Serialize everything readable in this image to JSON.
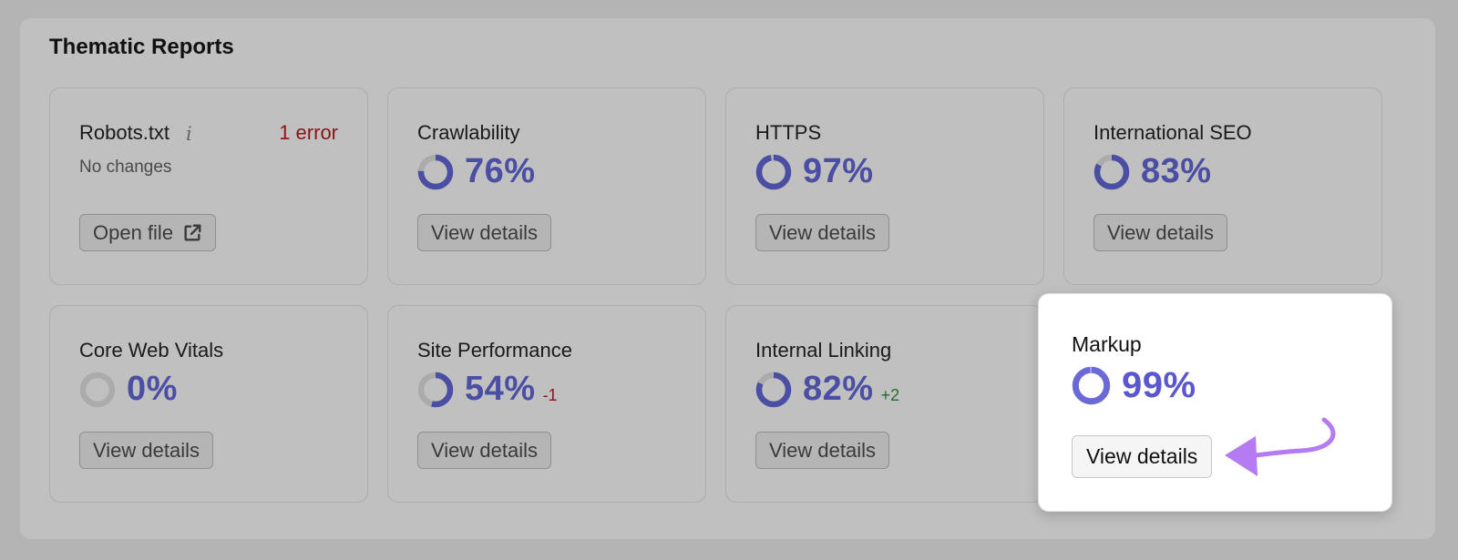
{
  "section": {
    "title": "Thematic Reports"
  },
  "colors": {
    "accent": "#4b4fa3",
    "highlight_accent": "#5a57cf",
    "error": "#8b1515",
    "positive": "#226b33",
    "arrow": "#b57bf2"
  },
  "cards": {
    "robots": {
      "title": "Robots.txt",
      "info_icon": "i",
      "error_label": "1 error",
      "status": "No changes",
      "button_label": "Open file",
      "button_icon": "external-link-icon"
    },
    "crawlability": {
      "title": "Crawlability",
      "score": "76%",
      "percent": 76,
      "button_label": "View details"
    },
    "https": {
      "title": "HTTPS",
      "score": "97%",
      "percent": 97,
      "button_label": "View details"
    },
    "international_seo": {
      "title": "International SEO",
      "score": "83%",
      "percent": 83,
      "button_label": "View details"
    },
    "core_web_vitals": {
      "title": "Core Web Vitals",
      "score": "0%",
      "percent": 0,
      "button_label": "View details"
    },
    "site_performance": {
      "title": "Site Performance",
      "score": "54%",
      "percent": 54,
      "delta": "-1",
      "button_label": "View details"
    },
    "internal_linking": {
      "title": "Internal Linking",
      "score": "82%",
      "percent": 82,
      "delta": "+2",
      "button_label": "View details"
    },
    "markup": {
      "title": "Markup",
      "score": "99%",
      "percent": 99,
      "button_label": "View details",
      "highlighted": true
    }
  }
}
